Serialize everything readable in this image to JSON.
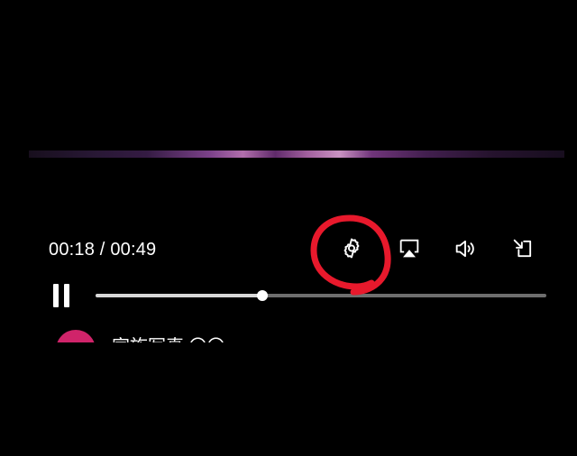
{
  "player": {
    "time_display": "00:18 / 00:49",
    "progress_fraction": 0.37
  },
  "controls": {
    "settings_icon": "gear-icon",
    "airplay_icon": "airplay-icon",
    "volume_icon": "volume-icon",
    "pip_icon": "pip-icon",
    "pause_icon": "pause-icon"
  },
  "annotation": {
    "color": "#e8192c"
  },
  "next_video": {
    "title": "家族写真 〇〇"
  }
}
